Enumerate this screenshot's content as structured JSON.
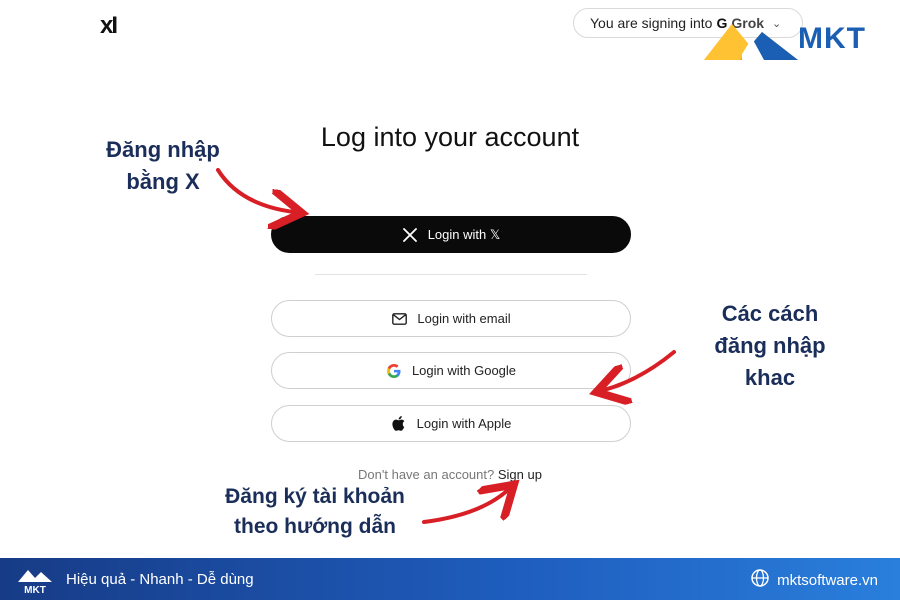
{
  "header": {
    "logo_text": "xI",
    "signing_prefix": "You are signing into",
    "signing_app_mark": "G",
    "signing_app_name": "Grok"
  },
  "brand_badge": {
    "text": "MKT",
    "colors": {
      "blue": "#1b5fb4",
      "orange": "#f4a300"
    }
  },
  "main": {
    "title": "Log into your account",
    "buttons": {
      "x": {
        "label": "Login with 𝕏",
        "icon": "x-logo-icon"
      },
      "email": {
        "label": "Login with email",
        "icon": "mail-icon"
      },
      "google": {
        "label": "Login with Google",
        "icon": "google-icon"
      },
      "apple": {
        "label": "Login with Apple",
        "icon": "apple-icon"
      }
    },
    "signup_prompt": "Don't have an account?",
    "signup_link": "Sign up"
  },
  "annotations": {
    "x_login_line1": "Đăng nhập",
    "x_login_line2": "bằng X",
    "other_line1": "Các cách",
    "other_line2": "đăng nhập",
    "other_line3": "khac",
    "signup_line1": "Đăng ký tài khoản",
    "signup_line2": "theo hướng dẫn",
    "color": "#1b2e5a",
    "arrow_color": "#d81f26"
  },
  "footer": {
    "logo_text": "MKT",
    "tagline": "Hiệu quả - Nhanh - Dễ dùng",
    "website": "mktsoftware.vn"
  }
}
